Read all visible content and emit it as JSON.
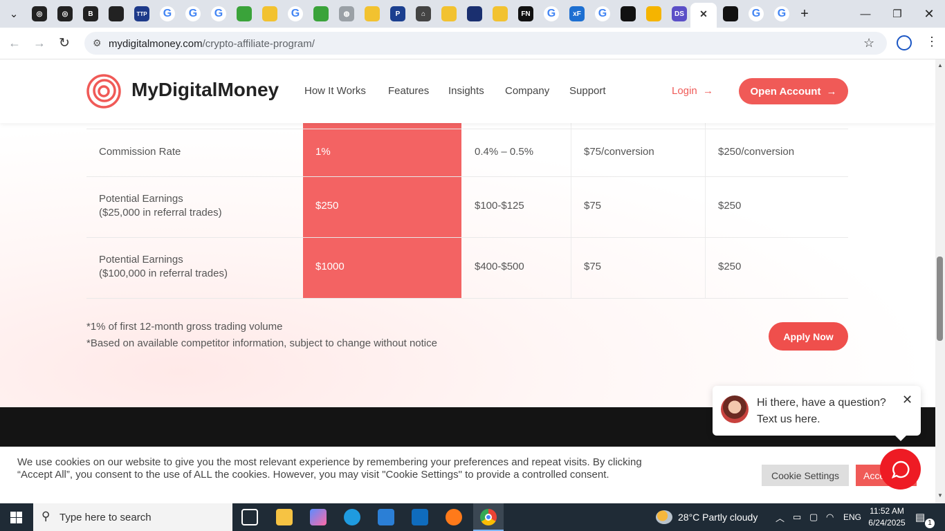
{
  "browser": {
    "url_domain": "mydigitalmoney.com",
    "url_path": "/crypto-affiliate-program/",
    "tab_icons": [
      "openai-icon",
      "openai-icon",
      "b-icon",
      "waveform-icon",
      "ttp-icon",
      "google-icon",
      "google-icon",
      "google-icon",
      "green-app-icon",
      "yellow-app-icon",
      "google-icon",
      "green-app-icon",
      "globe-icon",
      "yellow-app-icon",
      "paypal-icon",
      "chart-icon",
      "yellow-app-icon",
      "blue-app-icon",
      "yellow-app-icon",
      "fn-icon",
      "google-icon",
      "excel-icon",
      "google-icon",
      "dark-app-icon",
      "warning-icon",
      "ds-icon",
      "active-tab-close-icon",
      "dark-app-icon",
      "google-icon",
      "google-icon"
    ],
    "tab_icon_labels": {
      "ttp": "TTP",
      "p": "P",
      "fn": "FN",
      "x": "xF",
      "ds": "DS",
      "b": "B"
    }
  },
  "site": {
    "brand": "MyDigitalMoney",
    "nav": [
      "How It Works",
      "Features",
      "Insights",
      "Company",
      "Support"
    ],
    "login": "Login",
    "open_account": "Open Account",
    "rows": [
      {
        "label1": "Commission Rate",
        "label2": "",
        "v1": "1%",
        "v2": "0.4% – 0.5%",
        "v3": "$75/conversion",
        "v4": "$250/conversion"
      },
      {
        "label1": "Potential Earnings",
        "label2": "($25,000 in referral trades)",
        "v1": "$250",
        "v2": "$100-$125",
        "v3": "$75",
        "v4": "$250"
      },
      {
        "label1": "Potential Earnings",
        "label2": "($100,000 in referral trades)",
        "v1": "$1000",
        "v2": "$400-$500",
        "v3": "$75",
        "v4": "$250"
      }
    ],
    "note1": "*1% of first 12-month gross trading volume",
    "note2": "*Based on available competitor information, subject to change without notice",
    "apply_now": "Apply Now",
    "cookie_text": "We use cookies on our website to give you the most relevant experience by remembering your preferences and repeat visits. By clicking “Accept All”, you consent to the use of ALL the cookies. However, you may visit \"Cookie Settings\" to provide a controlled consent.",
    "cookie_settings": "Cookie Settings",
    "accept_all": "Accept All",
    "chat_line1": "Hi there, have a question?",
    "chat_line2": "Text us here.",
    "accent_color": "#f05a57"
  },
  "taskbar": {
    "search_placeholder": "Type here to search",
    "weather": "28°C  Partly cloudy",
    "lang": "ENG",
    "time": "11:52 AM",
    "date": "6/24/2025",
    "notifications": "1"
  }
}
